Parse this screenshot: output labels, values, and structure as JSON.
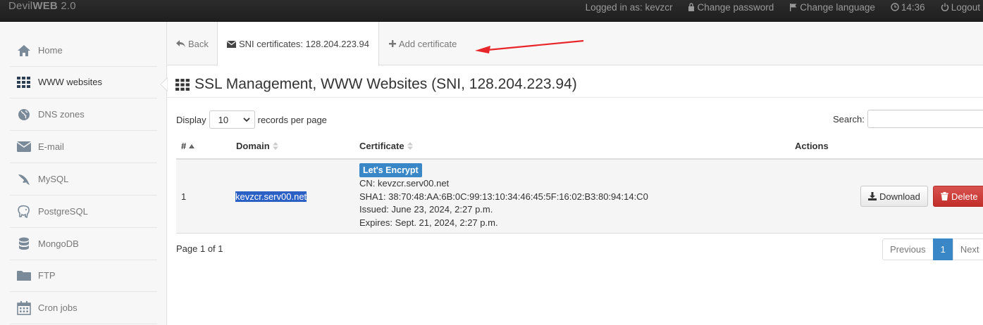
{
  "brand": {
    "light": "Devil",
    "bold": "WEB",
    "version": " 2.0"
  },
  "topnav": {
    "logged_in": "Logged in as: kevzcr",
    "change_password": "Change password",
    "change_language": "Change language",
    "time": "14:36",
    "logout": "Logout"
  },
  "sidebar": {
    "items": [
      {
        "label": "Home",
        "icon": "home-icon"
      },
      {
        "label": "WWW websites",
        "icon": "grid-icon"
      },
      {
        "label": "DNS zones",
        "icon": "globe-icon"
      },
      {
        "label": "E-mail",
        "icon": "envelope-icon"
      },
      {
        "label": "MySQL",
        "icon": "dolphin-icon"
      },
      {
        "label": "PostgreSQL",
        "icon": "elephant-icon"
      },
      {
        "label": "MongoDB",
        "icon": "database-icon"
      },
      {
        "label": "FTP",
        "icon": "folder-icon"
      },
      {
        "label": "Cron jobs",
        "icon": "calendar-icon"
      }
    ],
    "active_index": 1
  },
  "tabs": {
    "back": "Back",
    "sni": "SNI certificates: 128.204.223.94",
    "add": "Add certificate"
  },
  "page": {
    "title": "SSL Management, WWW Websites (SNI, 128.204.223.94)",
    "display_label": "Display",
    "records_per_page": "10",
    "records_label": "records per page",
    "search_label": "Search:",
    "search_value": ""
  },
  "table": {
    "headers": {
      "num": "#",
      "domain": "Domain",
      "certificate": "Certificate",
      "actions": "Actions"
    },
    "rows": [
      {
        "num": "1",
        "domain": "kevzcr.serv00.net",
        "badge": "Let's Encrypt",
        "cn": "CN: kevzcr.serv00.net",
        "sha1": "SHA1: 38:70:48:AA:6B:0C:99:13:10:34:46:45:5F:16:02:B3:80:94:14:C0",
        "issued": "Issued: June 23, 2024, 2:27 p.m.",
        "expires": "Expires: Sept. 21, 2024, 2:27 p.m.",
        "download": "Download",
        "delete": "Delete"
      }
    ]
  },
  "pagination": {
    "info": "Page 1 of 1",
    "previous": "Previous",
    "current": "1",
    "next": "Next"
  },
  "colors": {
    "primary": "#3a87c8",
    "danger": "#d9534f",
    "annotation_arrow": "#e8262a"
  }
}
